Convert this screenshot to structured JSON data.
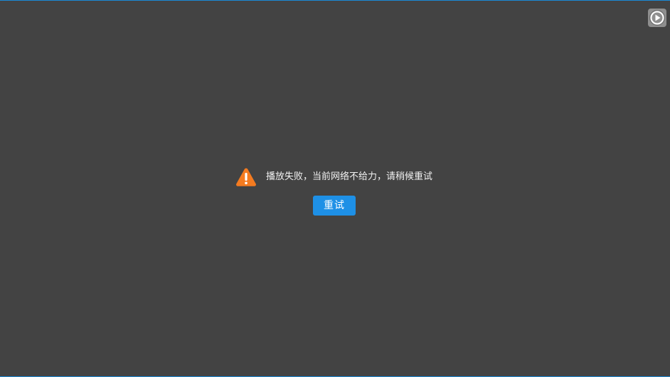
{
  "player": {
    "logo_icon": "play-circle-icon",
    "error": {
      "icon": "warning-triangle-icon",
      "icon_color": "#f47b20",
      "message": "播放失败，当前网络不给力，请稍候重试"
    },
    "retry_button": {
      "label": "重试",
      "color": "#1e90e6"
    },
    "background_color": "#434343",
    "border_color": "#1a8ad6"
  }
}
